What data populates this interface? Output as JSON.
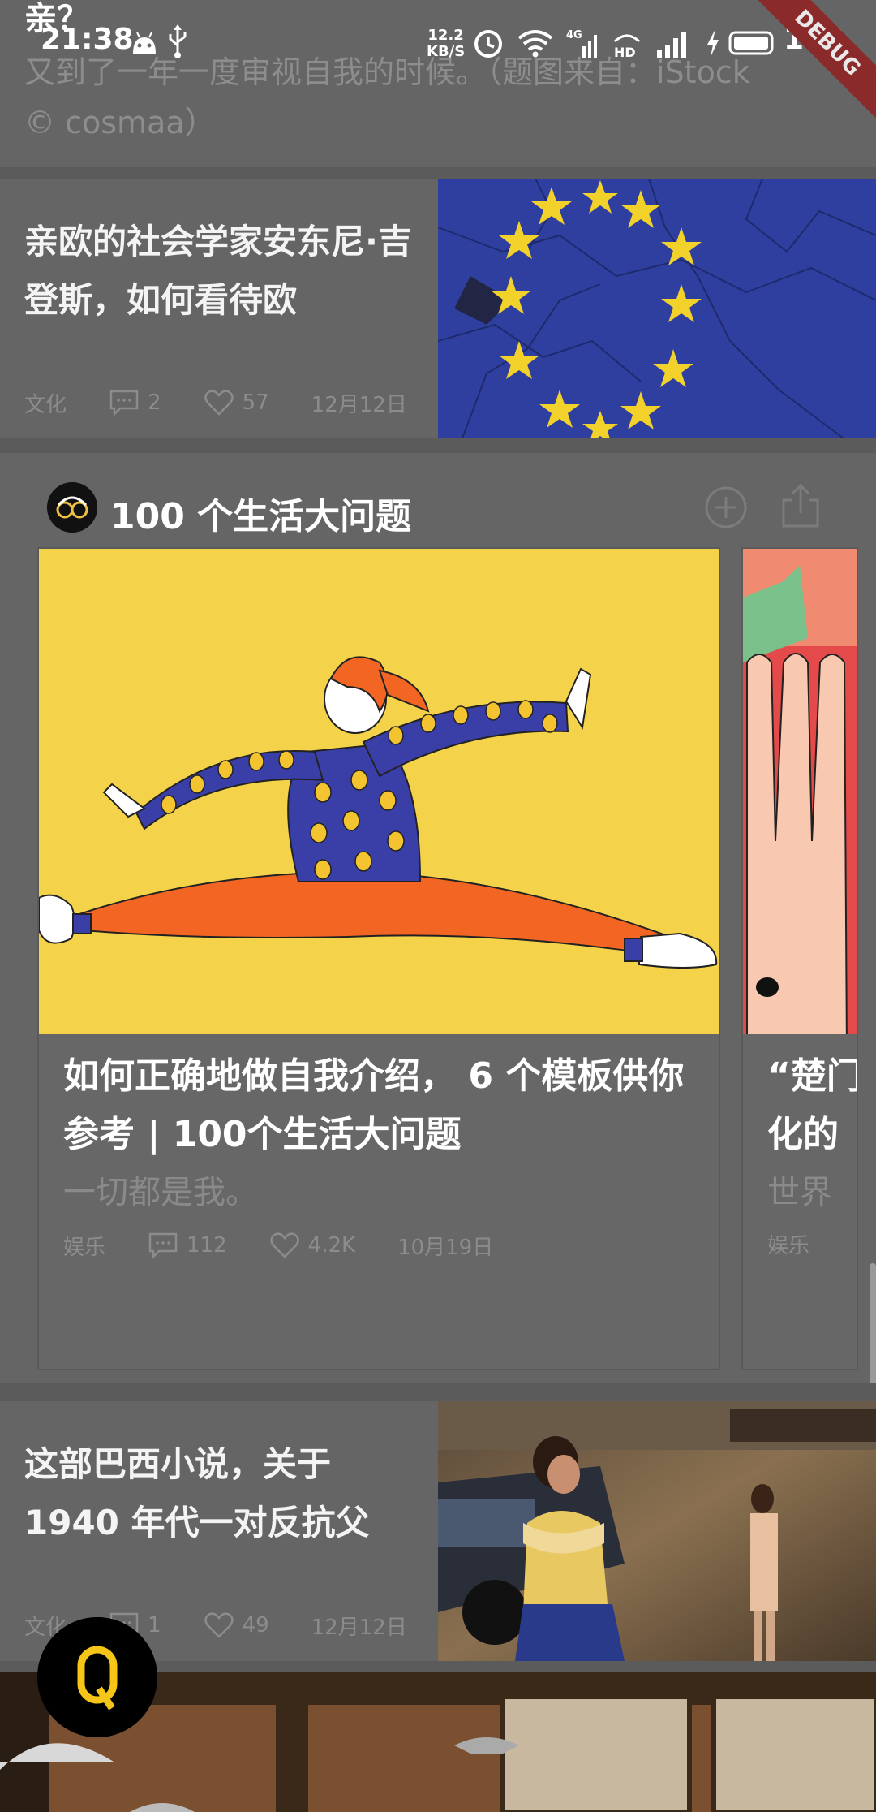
{
  "status_bar": {
    "time": "21:38",
    "net_speed_value": "12.2",
    "net_speed_unit": "KB/S",
    "battery": "100",
    "debug_label": "DEBUG"
  },
  "top_card": {
    "title_fragment": "亲？",
    "excerpt": "又到了一年一度审视自我的时候。（题图来自：iStock\n© cosmaa）"
  },
  "articles": [
    {
      "title": "亲欧的社会学家安东尼·吉登斯，如何看待欧",
      "category": "文化",
      "comments": "2",
      "likes": "57",
      "date": "12月12日"
    },
    {
      "title": "这部巴西小说，关于 1940 年代一对反抗父",
      "category": "文化",
      "comments": "1",
      "likes": "49",
      "date": "12月12日"
    }
  ],
  "collection": {
    "title": "100 个生活大问题",
    "feature": {
      "title": "如何正确地做自我介绍， 6 个模板供你参考 | 100个生活大问题",
      "subtitle": "一切都是我。",
      "category": "娱乐",
      "comments": "112",
      "likes": "4.2K",
      "date": "10月19日"
    },
    "peek": {
      "title_line1": "“楚门",
      "title_line2": "化的",
      "subtitle": "世界",
      "category": "娱乐"
    }
  },
  "fab": {
    "label": "Q",
    "color": "#f5c518"
  },
  "colors": {
    "overlay_background": "#6a6a6a",
    "eu_blue": "#2f3fa0",
    "eu_star": "#f2d12a",
    "illustration_yellow": "#f4d34a",
    "illustration_orange": "#f26522",
    "illustration_blue": "#3a3fa8"
  }
}
